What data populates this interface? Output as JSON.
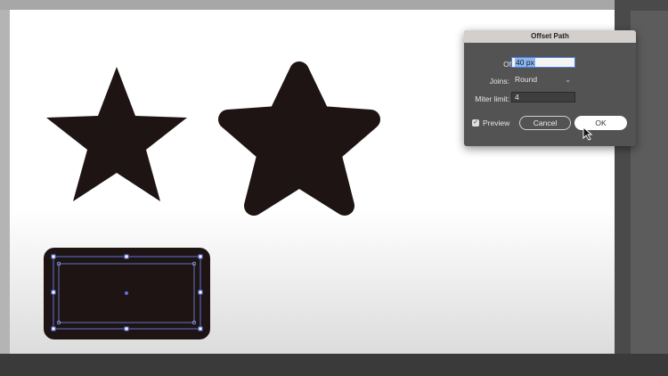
{
  "dialog": {
    "title": "Offset Path",
    "offset_label": "Offset:",
    "offset_value": "40 px",
    "joins_label": "Joins:",
    "joins_value": "Round",
    "miter_label": "Miter limit:",
    "miter_value": "4",
    "preview_label": "Preview",
    "preview_checked": true,
    "cancel_label": "Cancel",
    "ok_label": "OK"
  },
  "icons": {
    "preview_check": "check-icon",
    "joins_dropdown": "chevron-down-icon",
    "cursor": "arrow-cursor-icon"
  },
  "colors": {
    "shape_fill": "#1e1414",
    "selection": "#5e73d9",
    "dialog_bg": "#535353",
    "title_bar": "#d2cfcc"
  }
}
